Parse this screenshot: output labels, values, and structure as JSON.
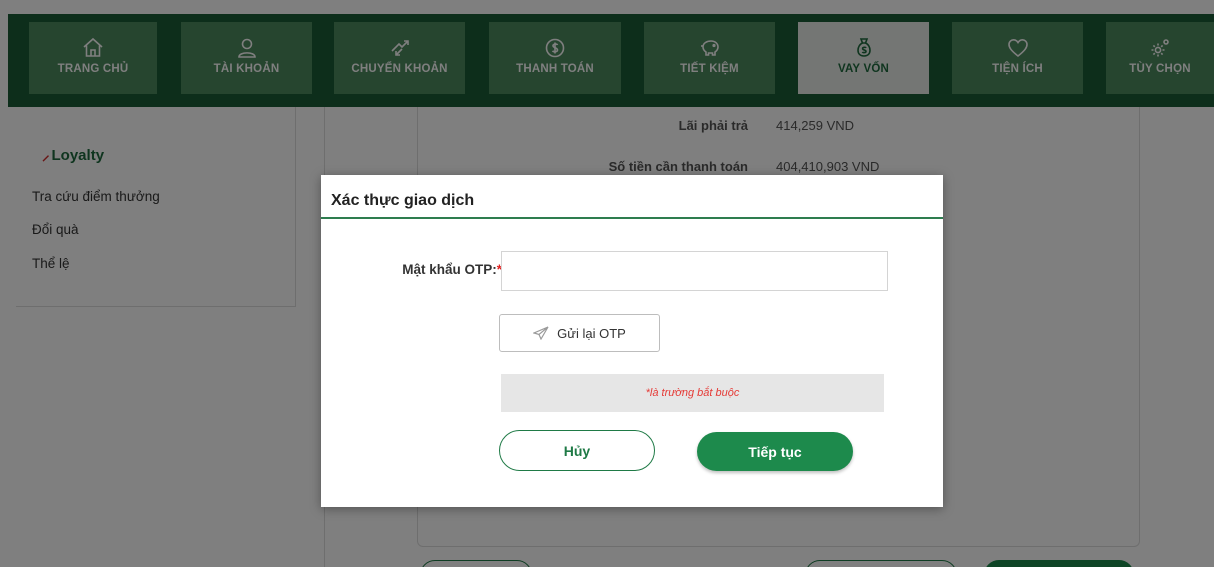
{
  "nav": {
    "items": [
      {
        "label": "TRANG CHỦ",
        "icon": "home-icon"
      },
      {
        "label": "TÀI KHOẢN",
        "icon": "user-icon"
      },
      {
        "label": "CHUYỂN KHOẢN",
        "icon": "transfer-icon"
      },
      {
        "label": "THANH TOÁN",
        "icon": "dollar-coin-icon"
      },
      {
        "label": "TIẾT KIỆM",
        "icon": "piggy-bank-icon"
      },
      {
        "label": "VAY VỐN",
        "icon": "money-bag-icon",
        "active": true
      },
      {
        "label": "TIỆN ÍCH",
        "icon": "heart-icon"
      },
      {
        "label": "TÙY CHỌN",
        "icon": "gear-icon"
      }
    ]
  },
  "sidebar": {
    "title": "Loyalty",
    "links": [
      "Tra cứu điểm thưởng",
      "Đổi quà",
      "Thể lệ"
    ]
  },
  "summary": {
    "rows": [
      {
        "label": "Lãi phải trả",
        "value": "414,259 VND"
      },
      {
        "label": "Số tiền cần thanh toán",
        "value": "404,410,903 VND"
      }
    ]
  },
  "modal": {
    "title": "Xác thực giao dịch",
    "otp_label": "Mật khẩu OTP:",
    "required_mark": "*",
    "otp_value": "",
    "resend_label": "Gửi lại OTP",
    "note": "*là trường bắt buộc",
    "cancel_label": "Hủy",
    "continue_label": "Tiếp tục"
  },
  "colors": {
    "nav_bg": "#1a5c36",
    "nav_item_bg": "#4d8a5f",
    "nav_active_bg": "#e8ece8",
    "accent_green": "#1d8a4c",
    "required_red": "#e02020"
  }
}
